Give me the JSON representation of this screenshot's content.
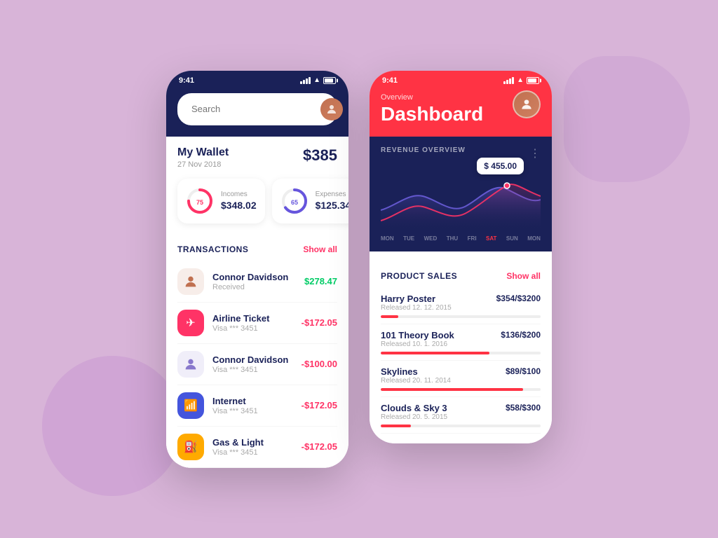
{
  "background": {
    "color": "#d8b4d8"
  },
  "phone_wallet": {
    "status": {
      "time": "9:41",
      "signal": "●●●",
      "wifi": "wifi",
      "battery": "battery"
    },
    "search": {
      "placeholder": "Search"
    },
    "wallet": {
      "title": "My Wallet",
      "date": "27 Nov 2018",
      "amount": "$385"
    },
    "incomes": {
      "label": "Incomes",
      "value": "$348.02",
      "percent": 75,
      "color": "#ff3366"
    },
    "expenses": {
      "label": "Expenses",
      "value": "$125.34",
      "percent": 65,
      "color": "#6655dd"
    },
    "transactions": {
      "title": "TRANSACTIONS",
      "show_all": "Show all",
      "items": [
        {
          "name": "Connor Davidson",
          "sub": "Received",
          "amount": "$278.47",
          "type": "positive",
          "icon_type": "avatar",
          "icon_color": "#c07050"
        },
        {
          "name": "Airline Ticket",
          "sub": "Visa *** 3451",
          "amount": "-$172.05",
          "type": "negative",
          "icon_type": "emoji",
          "emoji": "✈",
          "icon_color": "#ff3366"
        },
        {
          "name": "Connor Davidson",
          "sub": "Visa *** 3451",
          "amount": "-$100.00",
          "type": "negative",
          "icon_type": "avatar",
          "icon_color": "#8878cc"
        },
        {
          "name": "Internet",
          "sub": "Visa *** 3451",
          "amount": "-$172.05",
          "type": "negative",
          "icon_type": "emoji",
          "emoji": "📶",
          "icon_color": "#4455dd"
        },
        {
          "name": "Gas & Light",
          "sub": "Visa *** 3451",
          "amount": "-$172.05",
          "type": "negative",
          "icon_type": "emoji",
          "emoji": "⛽",
          "icon_color": "#ffaa00"
        }
      ]
    }
  },
  "phone_dashboard": {
    "status": {
      "time": "9:41"
    },
    "header": {
      "overview_label": "Overview",
      "title": "Dashboard"
    },
    "chart": {
      "title": "REVENUE OVERVIEW",
      "tooltip": "$ 455.00",
      "days": [
        "MON",
        "TUE",
        "WED",
        "THU",
        "FRI",
        "SAT",
        "SUN",
        "MON"
      ]
    },
    "product_sales": {
      "title": "PRODUCT SALES",
      "show_all": "Show all",
      "items": [
        {
          "name": "Harry Poster",
          "released": "Released 12. 12. 2015",
          "value": "$354/$3200",
          "progress": 11
        },
        {
          "name": "101 Theory Book",
          "released": "Released 10. 1. 2016",
          "value": "$136/$200",
          "progress": 68
        },
        {
          "name": "Skylines",
          "released": "Released 20. 11. 2014",
          "value": "$89/$100",
          "progress": 89
        },
        {
          "name": "Clouds & Sky 3",
          "released": "Released 20. 5. 2015",
          "value": "$58/$300",
          "progress": 19
        }
      ]
    }
  }
}
